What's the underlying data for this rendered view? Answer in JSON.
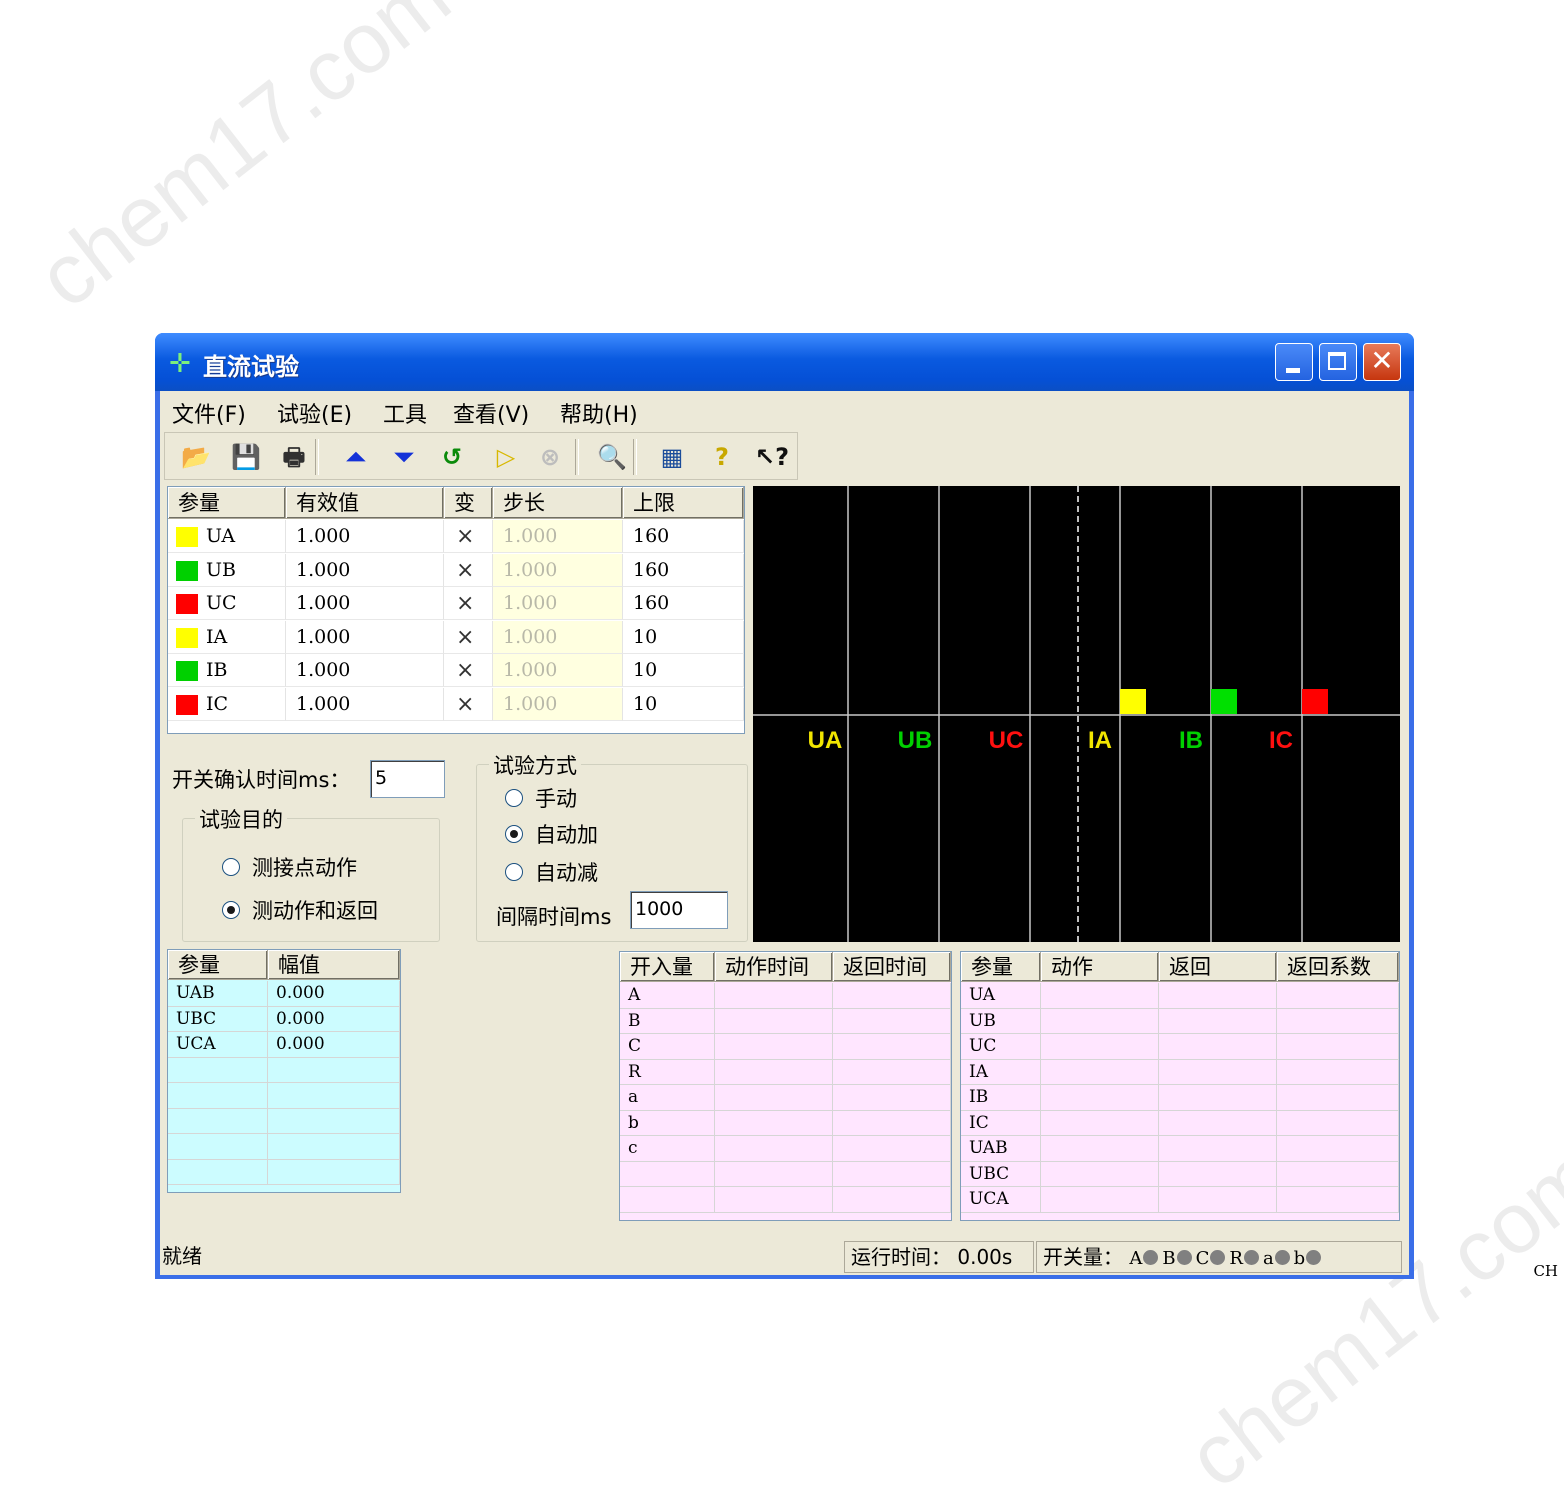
{
  "watermarks": [
    "chem17.com",
    "chem17.com"
  ],
  "ime_indicator": "CH",
  "window": {
    "title": "直流试验",
    "controls": [
      "minimize",
      "maximize",
      "close"
    ]
  },
  "menu": [
    "文件(F)",
    "试验(E)",
    "工具",
    "查看(V)",
    "帮助(H)"
  ],
  "toolbar": [
    {
      "name": "open-icon",
      "glyph": "📂",
      "color": "#c89a1e"
    },
    {
      "name": "save-icon",
      "glyph": "💾",
      "color": "#1a1a1a"
    },
    {
      "name": "print-icon",
      "glyph": "🖶",
      "color": "#303030"
    },
    {
      "name": "increase-icon",
      "glyph": "⏶",
      "color": "#1432d8"
    },
    {
      "name": "decrease-icon",
      "glyph": "⏷",
      "color": "#1432d8"
    },
    {
      "name": "return-icon",
      "glyph": "↺",
      "color": "#0a8a0a"
    },
    {
      "name": "run-icon",
      "glyph": "▷",
      "color": "#d8b800"
    },
    {
      "name": "stop-icon",
      "glyph": "⊗",
      "color": "#bdbdbd"
    },
    {
      "name": "zoom-icon",
      "glyph": "🔍",
      "color": "#c0321e"
    },
    {
      "name": "calculator-icon",
      "glyph": "▦",
      "color": "#1a4c9a"
    },
    {
      "name": "help-icon",
      "glyph": "?",
      "color": "#c8a800"
    },
    {
      "name": "context-help-icon",
      "glyph": "↖?",
      "color": "#101010"
    }
  ],
  "param_table": {
    "headers": [
      "参量",
      "有效值",
      "变",
      "步长",
      "上限"
    ],
    "rows": [
      {
        "name": "UA",
        "value": "1.000",
        "vary": "×",
        "step": "1.000",
        "limit": "160",
        "color": "#ffff00"
      },
      {
        "name": "UB",
        "value": "1.000",
        "vary": "×",
        "step": "1.000",
        "limit": "160",
        "color": "#00d000"
      },
      {
        "name": "UC",
        "value": "1.000",
        "vary": "×",
        "step": "1.000",
        "limit": "160",
        "color": "#ff0000"
      },
      {
        "name": "IA",
        "value": "1.000",
        "vary": "×",
        "step": "1.000",
        "limit": "10",
        "color": "#ffff00"
      },
      {
        "name": "IB",
        "value": "1.000",
        "vary": "×",
        "step": "1.000",
        "limit": "10",
        "color": "#00d000"
      },
      {
        "name": "IC",
        "value": "1.000",
        "vary": "×",
        "step": "1.000",
        "limit": "10",
        "color": "#ff0000"
      }
    ]
  },
  "scope": {
    "channels": [
      {
        "label": "UA",
        "color": "#f2e600",
        "level": 0
      },
      {
        "label": "UB",
        "color": "#00d000",
        "level": 0
      },
      {
        "label": "UC",
        "color": "#ff1010",
        "level": 0
      },
      {
        "label": "IA",
        "color": "#f2e600",
        "level": 0
      },
      {
        "label": "IB",
        "color": "#00d000",
        "level": 1
      },
      {
        "label": "IC",
        "color": "#ff1010",
        "level": 1
      }
    ],
    "bars": [
      {
        "channel": "IA",
        "color": "#ffff00"
      },
      {
        "channel": "IB",
        "color": "#00e000"
      },
      {
        "channel": "IC",
        "color": "#ff0000"
      }
    ]
  },
  "switch_confirm": {
    "label": "开关确认时间ms：",
    "value": "5"
  },
  "test_purpose": {
    "legend": "试验目的",
    "options": [
      {
        "label": "测接点动作",
        "checked": false
      },
      {
        "label": "测动作和返回",
        "checked": true
      }
    ]
  },
  "test_mode": {
    "legend": "试验方式",
    "options": [
      {
        "label": "手动",
        "checked": false
      },
      {
        "label": "自动加",
        "checked": true
      },
      {
        "label": "自动减",
        "checked": false
      }
    ],
    "interval_label": "间隔时间ms",
    "interval_value": "1000"
  },
  "amplitude_table": {
    "headers": [
      "参量",
      "幅值"
    ],
    "rows": [
      [
        "UAB",
        "0.000"
      ],
      [
        "UBC",
        "0.000"
      ],
      [
        "UCA",
        "0.000"
      ],
      [
        "",
        ""
      ],
      [
        "",
        ""
      ],
      [
        "",
        ""
      ],
      [
        "",
        ""
      ],
      [
        "",
        ""
      ]
    ]
  },
  "binary_table": {
    "headers": [
      "开入量",
      "动作时间",
      "返回时间"
    ],
    "rows": [
      [
        "A",
        "",
        ""
      ],
      [
        "B",
        "",
        ""
      ],
      [
        "C",
        "",
        ""
      ],
      [
        "R",
        "",
        ""
      ],
      [
        "a",
        "",
        ""
      ],
      [
        "b",
        "",
        ""
      ],
      [
        "c",
        "",
        ""
      ],
      [
        "",
        "",
        ""
      ],
      [
        "",
        "",
        ""
      ]
    ]
  },
  "result_table": {
    "headers": [
      "参量",
      "动作",
      "返回",
      "返回系数"
    ],
    "rows": [
      [
        "UA",
        "",
        "",
        ""
      ],
      [
        "UB",
        "",
        "",
        ""
      ],
      [
        "UC",
        "",
        "",
        ""
      ],
      [
        "IA",
        "",
        "",
        ""
      ],
      [
        "IB",
        "",
        "",
        ""
      ],
      [
        "IC",
        "",
        "",
        ""
      ],
      [
        "UAB",
        "",
        "",
        ""
      ],
      [
        "UBC",
        "",
        "",
        ""
      ],
      [
        "UCA",
        "",
        "",
        ""
      ]
    ]
  },
  "status": {
    "ready": "就绪",
    "runtime": "运行时间：  0.00s",
    "switches_label": "开关量：",
    "switches": [
      "A",
      "B",
      "C",
      "R",
      "a",
      "b"
    ]
  }
}
